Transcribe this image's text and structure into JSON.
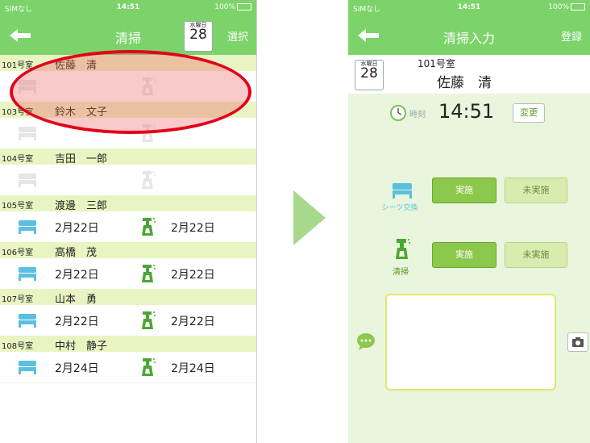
{
  "left": {
    "status": {
      "carrier": "SIMなし",
      "time": "14:51",
      "battery": "100%"
    },
    "nav": {
      "title": "清掃",
      "right": "選択"
    },
    "date": {
      "dow": "水曜日",
      "day": "28"
    },
    "rooms": [
      {
        "no": "101号室",
        "name": "佐藤　清",
        "bed_date": "",
        "clean_date": ""
      },
      {
        "no": "103号室",
        "name": "鈴木　文子",
        "bed_date": "",
        "clean_date": ""
      },
      {
        "no": "104号室",
        "name": "吉田　一郎",
        "bed_date": "",
        "clean_date": ""
      },
      {
        "no": "105号室",
        "name": "渡邊　三郎",
        "bed_date": "2月22日",
        "clean_date": "2月22日"
      },
      {
        "no": "106号室",
        "name": "高橋　茂",
        "bed_date": "2月22日",
        "clean_date": "2月22日"
      },
      {
        "no": "107号室",
        "name": "山本　勇",
        "bed_date": "2月22日",
        "clean_date": "2月22日"
      },
      {
        "no": "108号室",
        "name": "中村　静子",
        "bed_date": "2月24日",
        "clean_date": "2月24日"
      }
    ]
  },
  "right": {
    "status": {
      "carrier": "SIMなし",
      "time": "14:51",
      "battery": "100%"
    },
    "nav": {
      "title": "清掃入力",
      "right": "登録"
    },
    "date": {
      "dow": "水曜日",
      "day": "28"
    },
    "room_no": "101号室",
    "name": "佐藤　清",
    "time_label": "時刻",
    "time_value": "14:51",
    "change_label": "変更",
    "sheets_label": "シーツ交換",
    "clean_label": "清掃",
    "done_label": "実施",
    "notdone_label": "未実施"
  },
  "colors": {
    "brand": "#7bd36a",
    "header_row": "#e8f5c2",
    "highlight": "#e2001a",
    "bed": "#5bc0e0",
    "spray": "#4aa832"
  }
}
